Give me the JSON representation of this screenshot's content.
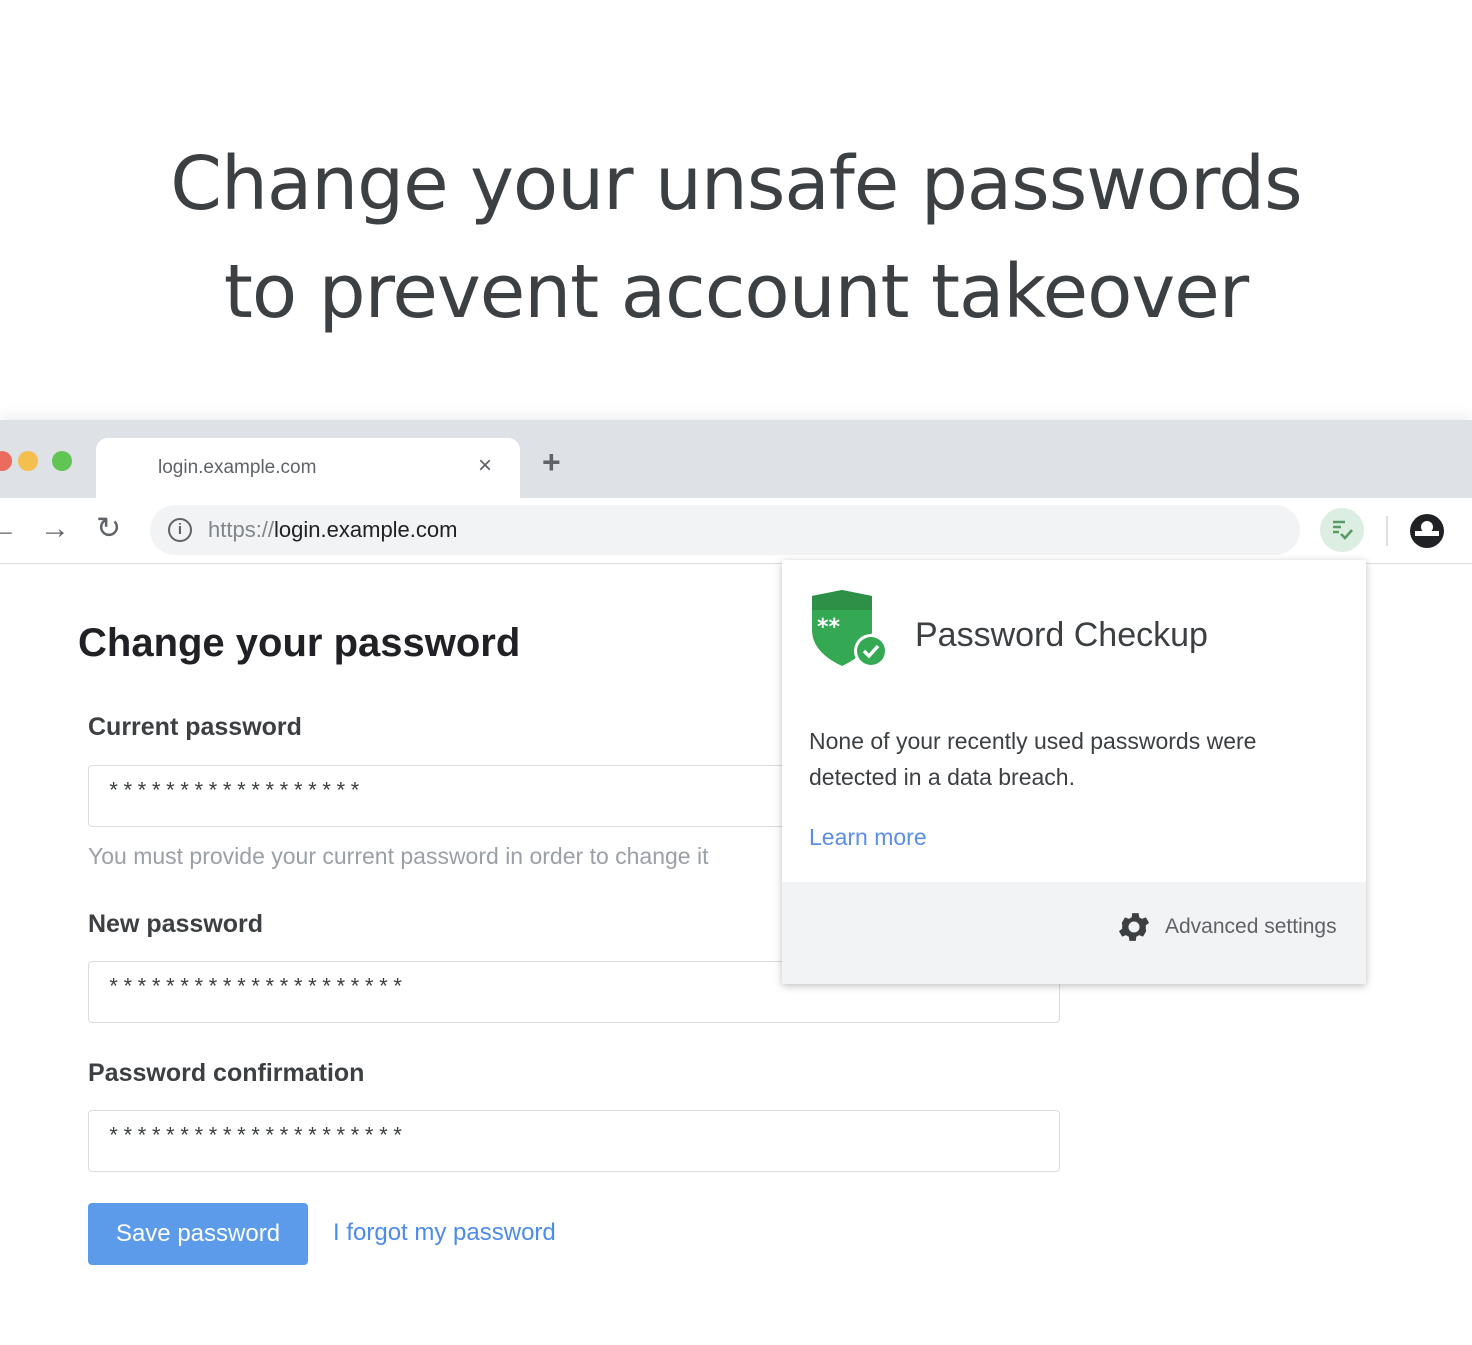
{
  "headline": {
    "line1": "Change your unsafe passwords",
    "line2": "to prevent account takeover"
  },
  "browser": {
    "tab": {
      "title": "login.example.com",
      "close_glyph": "×"
    },
    "new_tab_glyph": "+",
    "nav": {
      "back_glyph": "←",
      "forward_glyph": "→",
      "reload_glyph": "↻"
    },
    "address": {
      "scheme": "https://",
      "host": "login.example.com"
    },
    "icons": [
      "info-icon",
      "password-checkup-extension-icon",
      "account-icon"
    ]
  },
  "form": {
    "title": "Change your password",
    "current_label": "Current password",
    "current_value": "******************",
    "current_hint": "You must provide your current password in order to change it",
    "new_label": "New password",
    "new_value": "*********************",
    "confirm_label": "Password confirmation",
    "confirm_value": "*********************",
    "save_label": "Save password",
    "forgot_label": "I forgot my password"
  },
  "popup": {
    "title": "Password Checkup",
    "message": "None of your recently used passwords were detected in a data breach.",
    "learn_more": "Learn more",
    "advanced_settings": "Advanced settings"
  },
  "colors": {
    "shield_green": "#34a853",
    "save_button": "#5b9bea",
    "link_blue": "#4d8bea"
  }
}
